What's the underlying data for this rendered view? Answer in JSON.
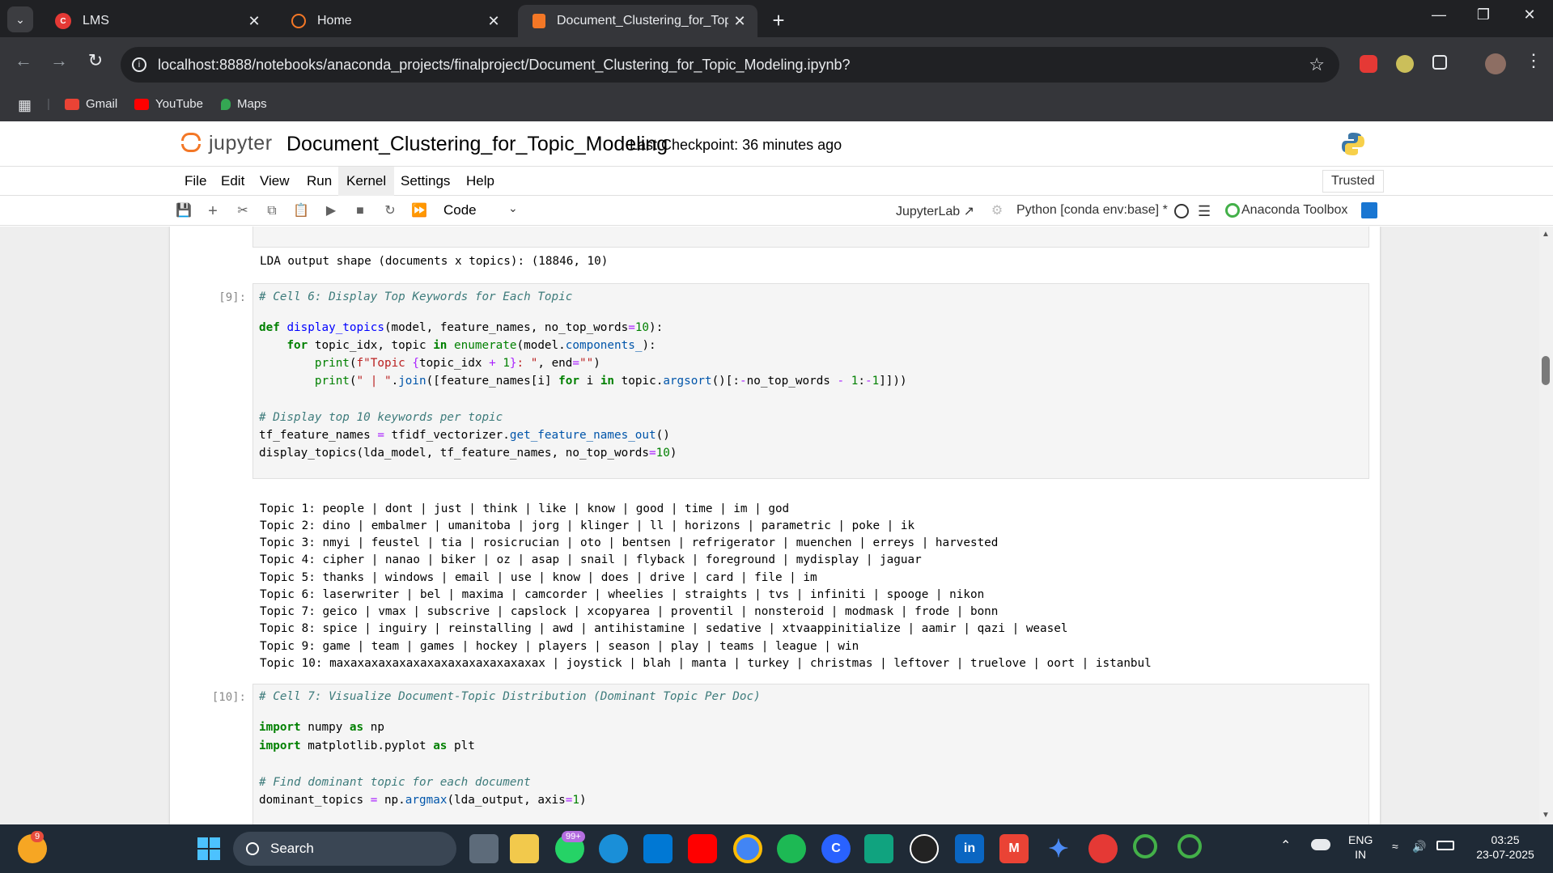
{
  "browser": {
    "tabs": [
      {
        "title": "LMS",
        "icon": "lms-icon"
      },
      {
        "title": "Home",
        "icon": "jupyter-loading-icon"
      },
      {
        "title": "Document_Clustering_for_Topic_Modeling",
        "icon": "jupyter-notebook-icon"
      }
    ],
    "url": "localhost:8888/notebooks/anaconda_projects/finalproject/Document_Clustering_for_Topic_Modeling.ipynb?",
    "bookmarks": [
      {
        "label": "Gmail",
        "icon": "gmail-icon"
      },
      {
        "label": "YouTube",
        "icon": "youtube-icon"
      },
      {
        "label": "Maps",
        "icon": "maps-icon"
      }
    ]
  },
  "jupyter": {
    "logo_text": "jupyter",
    "notebook_title": "Document_Clustering_for_Topic_Modeling",
    "checkpoint": "Last Checkpoint: 36 minutes ago",
    "menus": [
      "File",
      "Edit",
      "View",
      "Run",
      "Kernel",
      "Settings",
      "Help"
    ],
    "active_menu": "Kernel",
    "trusted": "Trusted",
    "cell_type": "Code",
    "jupyterlab_link": "JupyterLab",
    "kernel_name": "Python [conda env:base] *",
    "anaconda_toolbox": "Anaconda Toolbox"
  },
  "notebook": {
    "prev_output": "LDA output shape (documents x topics): (18846, 10)",
    "cell9": {
      "prompt": "[9]:",
      "comment1": "# Cell 6: Display Top Keywords for Each Topic",
      "comment2": "# Display top 10 keywords per topic"
    },
    "topics": [
      "Topic 1: people | dont | just | think | like | know | good | time | im | god",
      "Topic 2: dino | embalmer | umanitoba | jorg | klinger | ll | horizons | parametric | poke | ik",
      "Topic 3: nmyi | feustel | tia | rosicrucian | oto | bentsen | refrigerator | muenchen | erreys | harvested",
      "Topic 4: cipher | nanao | biker | oz | asap | snail | flyback | foreground | mydisplay | jaguar",
      "Topic 5: thanks | windows | email | use | know | does | drive | card | file | im",
      "Topic 6: laserwriter | bel | maxima | camcorder | wheelies | straights | tvs | infiniti | spooge | nikon",
      "Topic 7: geico | vmax | subscrive | capslock | xcopyarea | proventil | nonsteroid | modmask | frode | bonn",
      "Topic 8: spice | inguiry | reinstalling | awd | antihistamine | sedative | xtvaappinitialize | aamir | qazi | weasel",
      "Topic 9: game | team | games | hockey | players | season | play | teams | league | win",
      "Topic 10: maxaxaxaxaxaxaxaxaxaxaxaxaxaxax | joystick | blah | manta | turkey | christmas | leftover | truelove | oort | istanbul"
    ],
    "cell10": {
      "prompt": "[10]:",
      "comment1": "# Cell 7: Visualize Document-Topic Distribution (Dominant Topic Per Doc)",
      "comment2": "# Find dominant topic for each document"
    }
  },
  "taskbar": {
    "search_placeholder": "Search",
    "notification_count": "9",
    "whatsapp_badge": "99+",
    "language": "ENG",
    "region": "IN",
    "time": "03:25",
    "date": "23-07-2025"
  }
}
